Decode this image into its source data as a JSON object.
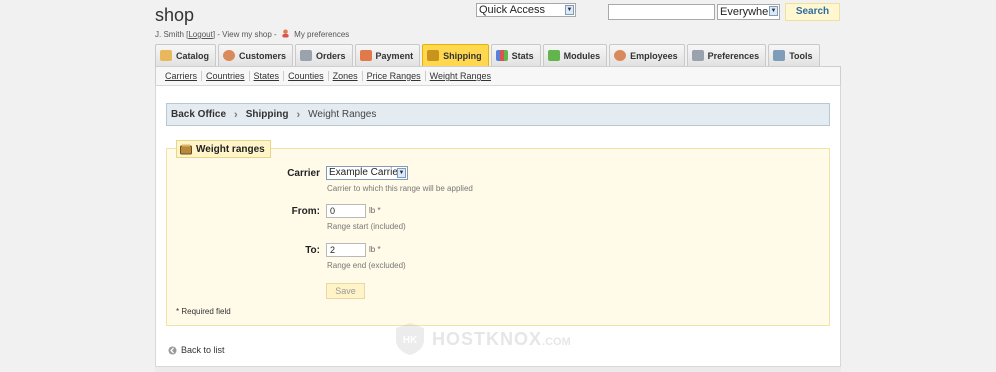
{
  "header": {
    "shop_title": "shop",
    "user_name": "J. Smith",
    "logout": "Logout",
    "view_my_shop": "View my shop",
    "my_preferences": "My preferences",
    "quick_access": "Quick Access",
    "search_scope": "Everywhere",
    "search_button": "Search",
    "search_value": ""
  },
  "tabs": [
    {
      "label": "Catalog",
      "icon": "catalog-icon",
      "color": "#e8b85a"
    },
    {
      "label": "Customers",
      "icon": "customers-icon",
      "color": "#d98a5a"
    },
    {
      "label": "Orders",
      "icon": "orders-icon",
      "color": "#9aa3ad"
    },
    {
      "label": "Payment",
      "icon": "payment-icon",
      "color": "#e07a4a"
    },
    {
      "label": "Shipping",
      "icon": "shipping-icon",
      "color": "#c8941c"
    },
    {
      "label": "Stats",
      "icon": "stats-icon",
      "color": "#5a7fd9"
    },
    {
      "label": "Modules",
      "icon": "modules-icon",
      "color": "#62b44d"
    },
    {
      "label": "Employees",
      "icon": "employees-icon",
      "color": "#d98a5a"
    },
    {
      "label": "Preferences",
      "icon": "preferences-icon",
      "color": "#9aa3ad"
    },
    {
      "label": "Tools",
      "icon": "tools-icon",
      "color": "#7f9db9"
    }
  ],
  "subtabs": [
    "Carriers",
    "Countries",
    "States",
    "Counties",
    "Zones",
    "Price Ranges",
    "Weight Ranges"
  ],
  "breadcrumb": {
    "root": "Back Office",
    "section": "Shipping",
    "current": "Weight Ranges"
  },
  "form": {
    "legend": "Weight ranges",
    "carrier_label": "Carrier",
    "carrier_value": "Example Carrier",
    "carrier_hint": "Carrier to which this range will be applied",
    "from_label": "From:",
    "from_value": "0",
    "from_hint": "Range start (included)",
    "to_label": "To:",
    "to_value": "2",
    "to_hint": "Range end (excluded)",
    "unit": "lb *",
    "save": "Save",
    "required_note": "* Required field",
    "back_link": "Back to list"
  },
  "watermark": {
    "brand": "HOSTKNOX",
    "suffix": ".COM",
    "badge": "HK"
  },
  "colors": {
    "active_tab": "#ffd84f",
    "search_text": "#2d6ca2",
    "form_bg": "#fffbe8"
  }
}
